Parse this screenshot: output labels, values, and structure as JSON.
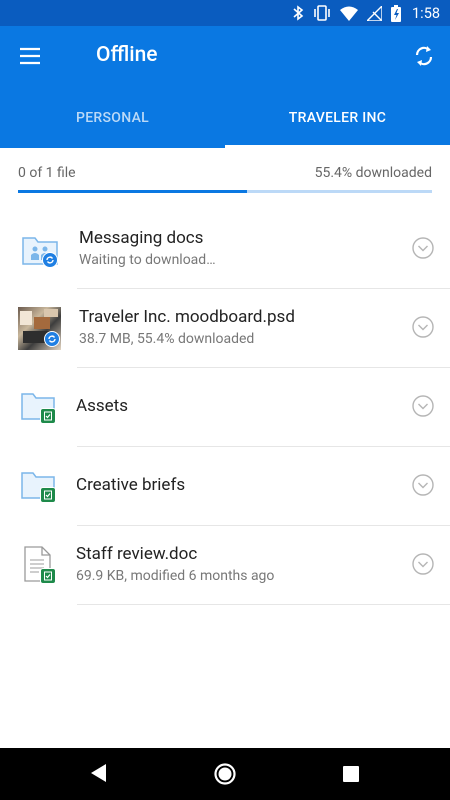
{
  "status_bar": {
    "time": "1:58",
    "icons": [
      "bluetooth-icon",
      "vibrate-icon",
      "wifi-icon",
      "no-signal-icon",
      "battery-charging-icon"
    ]
  },
  "app_bar": {
    "title": "Offline",
    "menu_icon": "hamburger-menu-icon",
    "refresh_icon": "sync-refresh-icon"
  },
  "tabs": [
    {
      "label": "PERSONAL",
      "active": false
    },
    {
      "label": "TRAVELER INC",
      "active": true
    }
  ],
  "progress": {
    "left_text": "0 of 1 file",
    "right_text": "55.4% downloaded",
    "percent": 55.4
  },
  "items": [
    {
      "name": "Messaging docs",
      "subtitle": "Waiting to download…",
      "icon": "shared-folder-icon",
      "badge": "sync-badge-icon"
    },
    {
      "name": "Traveler Inc. moodboard.psd",
      "subtitle": "38.7 MB, 55.4% downloaded",
      "icon": "image-thumbnail",
      "badge": "sync-badge-icon"
    },
    {
      "name": "Assets",
      "subtitle": "",
      "icon": "folder-icon",
      "badge": "offline-check-badge-icon"
    },
    {
      "name": "Creative briefs",
      "subtitle": "",
      "icon": "folder-icon",
      "badge": "offline-check-badge-icon"
    },
    {
      "name": "Staff review.doc",
      "subtitle": "69.9 KB, modified 6 months ago",
      "icon": "document-icon",
      "badge": "offline-check-badge-icon"
    }
  ],
  "colors": {
    "primary": "#0a78e2",
    "status_bar": "#0a5cbf",
    "sync_badge": "#1f7fe3",
    "offline_badge": "#1e8a4a"
  },
  "nav_bar": {
    "buttons": [
      "back-icon",
      "home-icon",
      "recents-icon"
    ]
  }
}
